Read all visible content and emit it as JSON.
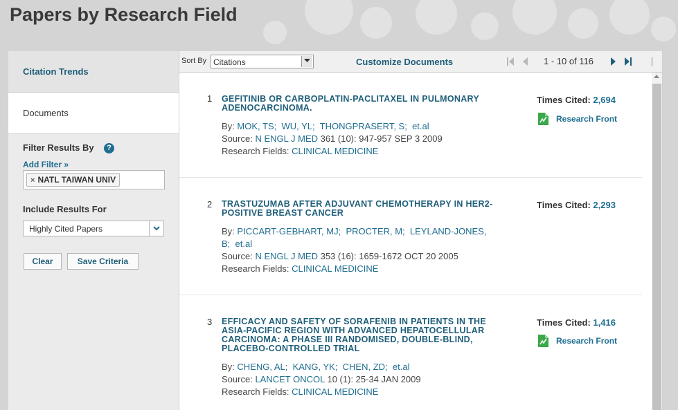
{
  "page": {
    "title": "Papers by Research Field"
  },
  "sidebar": {
    "citation_trends": "Citation Trends",
    "documents": "Documents",
    "filter_results_by": "Filter Results By",
    "help": "?",
    "add_filter": "Add Filter »",
    "active_filter": "NATL TAIWAN UNIV",
    "remove_glyph": "×",
    "include_results_for": "Include Results For",
    "include_value": "Highly Cited Papers",
    "clear_label": "Clear",
    "save_label": "Save Criteria"
  },
  "toolbar": {
    "sort_by_label": "Sort By",
    "sort_value": "Citations",
    "customize_label": "Customize Documents",
    "page_range": "1 - 10 of 116",
    "separator": "|"
  },
  "records": [
    {
      "num": "1",
      "title": "GEFITINIB OR CARBOPLATIN-PACLITAXEL IN PULMONARY ADENOCARCINOMA.",
      "by_label": "By:",
      "authors": [
        "MOK, TS;",
        "WU, YL;",
        "THONGPRASERT, S;",
        "et.al"
      ],
      "source_label": "Source:",
      "journal": "N ENGL J MED",
      "source_detail": "361 (10): 947-957 SEP 3 2009",
      "fields_label": "Research Fields:",
      "field": "CLINICAL MEDICINE",
      "times_cited_label": "Times Cited:",
      "times_cited": "2,694",
      "research_front": "Research Front"
    },
    {
      "num": "2",
      "title": "TRASTUZUMAB AFTER ADJUVANT CHEMOTHERAPY IN HER2-POSITIVE BREAST CANCER",
      "by_label": "By:",
      "authors": [
        "PICCART-GEBHART, MJ;",
        "PROCTER, M;",
        "LEYLAND-JONES,",
        "B;",
        "et.al"
      ],
      "source_label": "Source:",
      "journal": "N ENGL J MED",
      "source_detail": "353 (16): 1659-1672 OCT 20 2005",
      "fields_label": "Research Fields:",
      "field": "CLINICAL MEDICINE",
      "times_cited_label": "Times Cited:",
      "times_cited": "2,293"
    },
    {
      "num": "3",
      "title": "EFFICACY AND SAFETY OF SORAFENIB IN PATIENTS IN THE ASIA-PACIFIC REGION WITH ADVANCED HEPATOCELLULAR CARCINOMA: A PHASE III RANDOMISED, DOUBLE-BLIND, PLACEBO-CONTROLLED TRIAL",
      "by_label": "By:",
      "authors": [
        "CHENG, AL;",
        "KANG, YK;",
        "CHEN, ZD;",
        "et.al"
      ],
      "source_label": "Source:",
      "journal": "LANCET ONCOL",
      "source_detail": "10 (1): 25-34 JAN 2009",
      "fields_label": "Research Fields:",
      "field": "CLINICAL MEDICINE",
      "times_cited_label": "Times Cited:",
      "times_cited": "1,416",
      "research_front": "Research Front"
    }
  ],
  "colors": {
    "link": "#1f6e91",
    "title": "#1f5f7a",
    "research_front_icon": "#3aa84a"
  },
  "icons": [
    "help-icon",
    "remove-icon",
    "chevron-down-icon",
    "first-page-icon",
    "prev-page-icon",
    "next-page-icon",
    "last-page-icon",
    "research-front-icon"
  ]
}
